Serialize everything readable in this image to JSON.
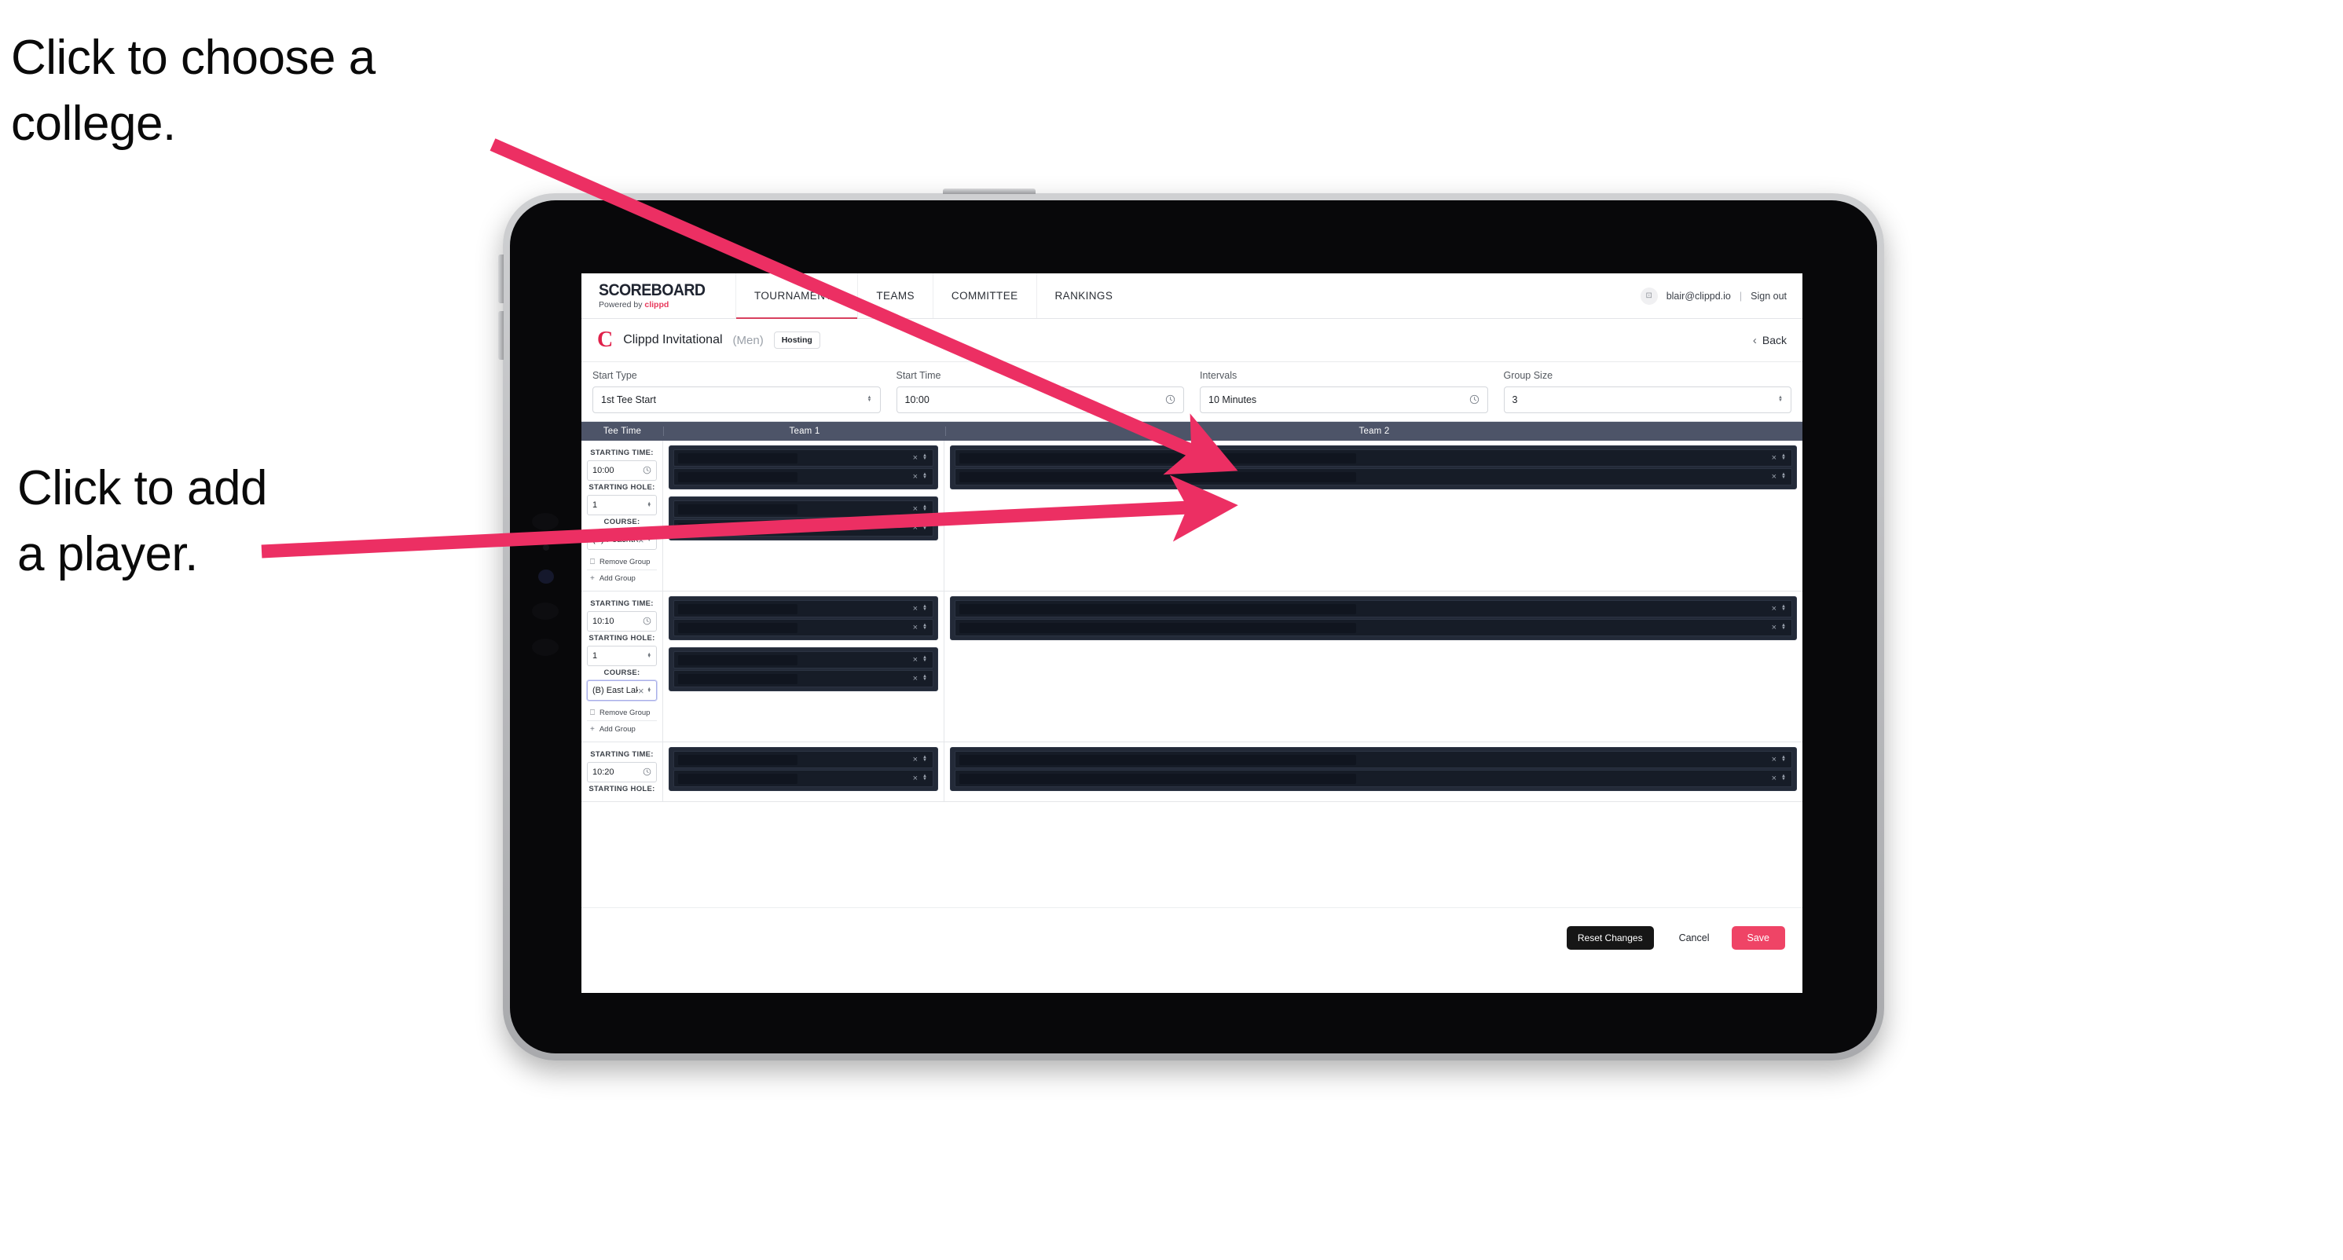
{
  "annotations": {
    "college": "Click to choose a\ncollege.",
    "player": "Click to add\na player.",
    "arrow_color": "#ec2f63"
  },
  "nav": {
    "brand_title": "SCOREBOARD",
    "brand_sub_prefix": "Powered by ",
    "brand_sub_name": "clippd",
    "tabs": [
      {
        "label": "TOURNAMENTS",
        "active": true
      },
      {
        "label": "TEAMS",
        "active": false
      },
      {
        "label": "COMMITTEE",
        "active": false
      },
      {
        "label": "RANKINGS",
        "active": false
      }
    ],
    "avatar_icon": "user-avatar-icon",
    "user_email": "blair@clippd.io",
    "separator": "|",
    "sign_out": "Sign out"
  },
  "tournament": {
    "logo_letter": "C",
    "name": "Clippd Invitational",
    "gender": "(Men)",
    "badge": "Hosting",
    "back_label": "Back",
    "back_icon": "chevron-left-icon"
  },
  "settings": [
    {
      "label": "Start Type",
      "value": "1st Tee Start",
      "icon": "stepper-icon"
    },
    {
      "label": "Start Time",
      "value": "10:00",
      "icon": "clock-icon"
    },
    {
      "label": "Intervals",
      "value": "10 Minutes",
      "icon": "clock-icon"
    },
    {
      "label": "Group Size",
      "value": "3",
      "icon": "stepper-icon"
    }
  ],
  "table": {
    "headers": {
      "tee_time": "Tee Time",
      "team1": "Team 1",
      "team2": "Team 2"
    },
    "field_labels": {
      "starting_time": "STARTING TIME:",
      "starting_hole": "STARTING HOLE:",
      "course": "COURSE:"
    },
    "actions": {
      "remove_group": "Remove Group",
      "remove_icon": "trash-icon",
      "add_group": "Add Group",
      "add_icon": "plus-icon"
    },
    "groups": [
      {
        "starting_time": "10:00",
        "starting_hole": "1",
        "course": "(A) Peachtree GC",
        "course_focused": false,
        "team1": [
          {
            "rows": [
              {
                "fill_pct": 48
              },
              {
                "fill_pct": 48
              }
            ]
          },
          {
            "rows": [
              {
                "fill_pct": 48
              },
              {
                "fill_pct": 48
              }
            ]
          }
        ],
        "team2": [
          {
            "rows": [
              {
                "fill_pct": 48
              },
              {
                "fill_pct": 48
              }
            ]
          }
        ]
      },
      {
        "starting_time": "10:10",
        "starting_hole": "1",
        "course": "(B) East Lake GC",
        "course_focused": true,
        "team1": [
          {
            "rows": [
              {
                "fill_pct": 48
              },
              {
                "fill_pct": 48
              }
            ]
          },
          {
            "rows": [
              {
                "fill_pct": 48
              },
              {
                "fill_pct": 48
              }
            ]
          }
        ],
        "team2": [
          {
            "rows": [
              {
                "fill_pct": 48
              },
              {
                "fill_pct": 48
              }
            ]
          }
        ]
      },
      {
        "starting_time": "10:20",
        "starting_hole": "",
        "course": "",
        "course_focused": false,
        "team1": [
          {
            "rows": [
              {
                "fill_pct": 48
              },
              {
                "fill_pct": 48
              }
            ]
          }
        ],
        "team2": [
          {
            "rows": [
              {
                "fill_pct": 48
              },
              {
                "fill_pct": 48
              }
            ]
          }
        ]
      }
    ]
  },
  "footer": {
    "reset": "Reset Changes",
    "cancel": "Cancel",
    "save": "Save"
  },
  "icons": {
    "close": "×",
    "clock": "◴",
    "plus": "+",
    "trash": "☐",
    "chevron_left": "‹",
    "avatar": "⊡"
  }
}
